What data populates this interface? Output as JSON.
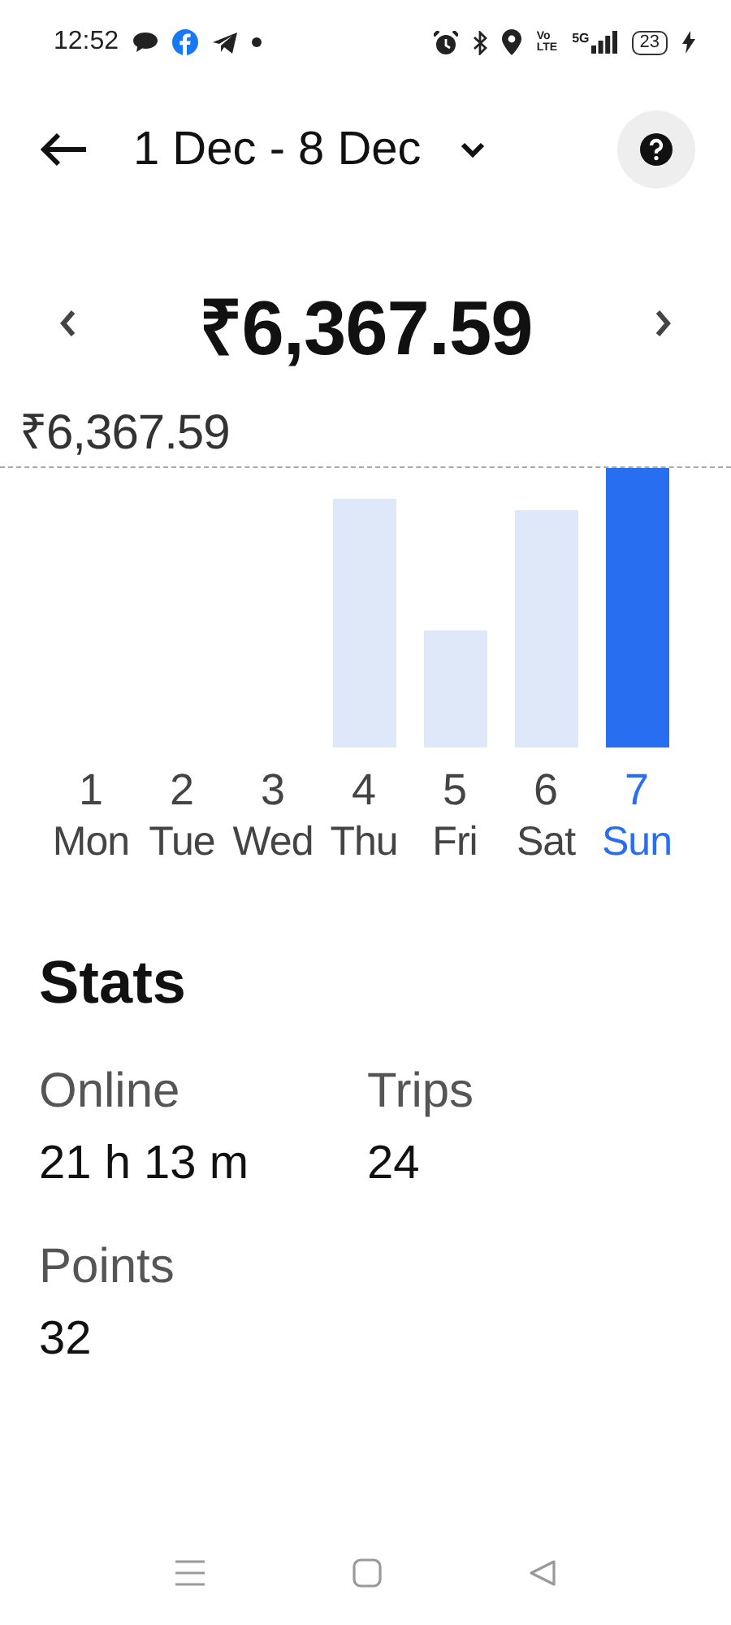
{
  "status_bar": {
    "time": "12:52",
    "volte_top": "Vo",
    "volte_bottom": "LTE",
    "network": "5G",
    "battery": "23"
  },
  "header": {
    "date_range": "1 Dec - 8 Dec"
  },
  "summary": {
    "amount": "₹6,367.59"
  },
  "chart": {
    "max_label": "₹6,367.59",
    "days": [
      {
        "number": "1",
        "name": "Mon",
        "selected": false
      },
      {
        "number": "2",
        "name": "Tue",
        "selected": false
      },
      {
        "number": "3",
        "name": "Wed",
        "selected": false
      },
      {
        "number": "4",
        "name": "Thu",
        "selected": false
      },
      {
        "number": "5",
        "name": "Fri",
        "selected": false
      },
      {
        "number": "6",
        "name": "Sat",
        "selected": false
      },
      {
        "number": "7",
        "name": "Sun",
        "selected": true
      }
    ]
  },
  "stats": {
    "title": "Stats",
    "items": [
      {
        "label": "Online",
        "value": "21 h 13 m"
      },
      {
        "label": "Trips",
        "value": "24"
      },
      {
        "label": "Points",
        "value": "32"
      }
    ]
  }
}
